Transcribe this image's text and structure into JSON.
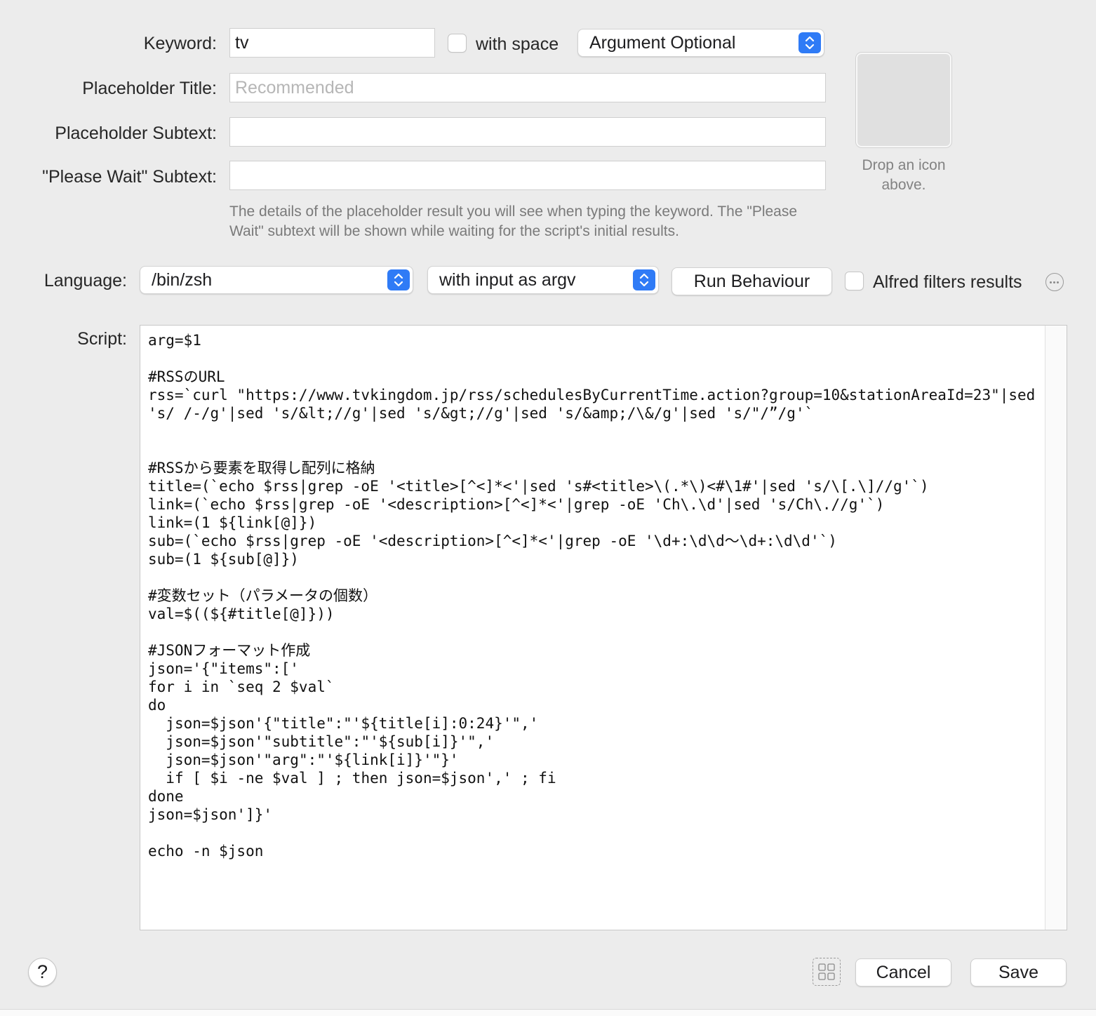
{
  "form": {
    "keyword_label": "Keyword:",
    "keyword_value": "tv",
    "with_space_label": "with space",
    "argument_option": "Argument Optional",
    "placeholder_title_label": "Placeholder Title:",
    "placeholder_title_placeholder": "Recommended",
    "placeholder_subtext_label": "Placeholder Subtext:",
    "please_wait_label": "\"Please Wait\" Subtext:",
    "help_text": "The details of the placeholder result you will see when typing the keyword. The \"Please Wait\" subtext will be shown while waiting for the script's initial results."
  },
  "icon_well": {
    "hint": "Drop an icon above."
  },
  "language_row": {
    "language_label": "Language:",
    "language_value": "/bin/zsh",
    "input_mode": "with input as argv",
    "run_behaviour_label": "Run Behaviour",
    "alfred_filters_label": "Alfred filters results"
  },
  "script": {
    "label": "Script:",
    "content": "arg=$1\n\n#RSSのURL\nrss=`curl \"https://www.tvkingdom.jp/rss/schedulesByCurrentTime.action?group=10&stationAreaId=23\"|sed 's/ /-/g'|sed 's/&lt;//g'|sed 's/&gt;//g'|sed 's/&amp;/\\&/g'|sed 's/\"/”/g'`\n\n\n#RSSから要素を取得し配列に格納\ntitle=(`echo $rss|grep -oE '<title>[^<]*<'|sed 's#<title>\\(.*\\)<#\\1#'|sed 's/\\[.\\]//g'`)\nlink=(`echo $rss|grep -oE '<description>[^<]*<'|grep -oE 'Ch\\.\\d'|sed 's/Ch\\.//g'`)\nlink=(1 ${link[@]})\nsub=(`echo $rss|grep -oE '<description>[^<]*<'|grep -oE '\\d+:\\d\\d〜\\d+:\\d\\d'`)\nsub=(1 ${sub[@]})\n\n#変数セット（パラメータの個数）\nval=$((${#title[@]}))\n\n#JSONフォーマット作成\njson='{\"items\":['\nfor i in `seq 2 $val`\ndo\n  json=$json'{\"title\":\"'${title[i]:0:24}'\",'\n  json=$json'\"subtitle\":\"'${sub[i]}'\",'\n  json=$json'\"arg\":\"'${link[i]}'\"}'\n  if [ $i -ne $val ] ; then json=$json',' ; fi\ndone\njson=$json']}'\n\necho -n $json"
  },
  "footer": {
    "help_label": "?",
    "cancel_label": "Cancel",
    "save_label": "Save"
  },
  "colors": {
    "accent": "#2f7bf6",
    "window_bg": "#ececec"
  }
}
